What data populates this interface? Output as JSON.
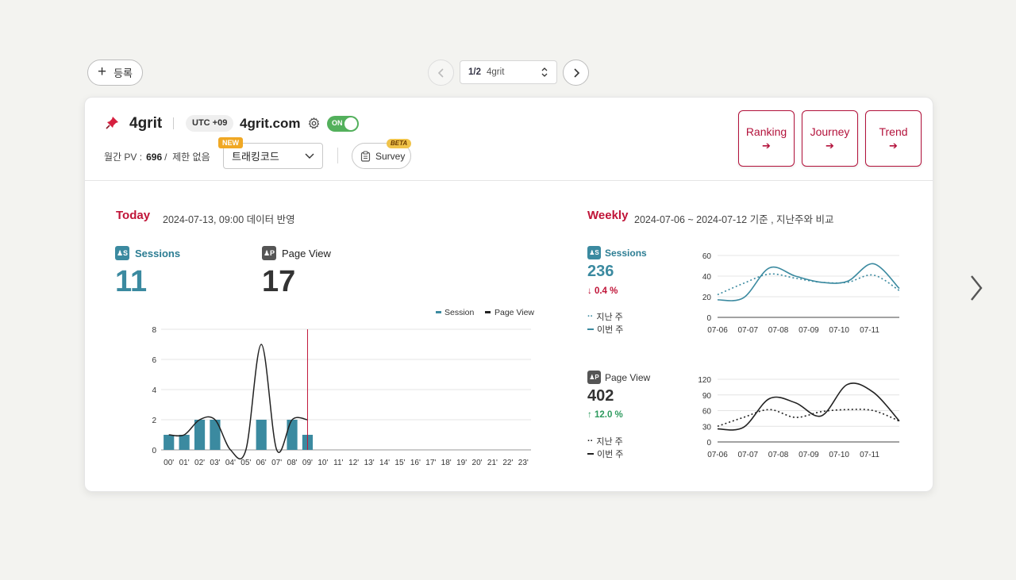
{
  "toolbar": {
    "register_label": "등록",
    "pager_current": "1",
    "pager_total": "2",
    "pager_site": "4grit"
  },
  "site": {
    "name": "4grit",
    "utc": "UTC +09",
    "domain": "4grit.com",
    "toggle_label": "ON",
    "pv_label": "월간 PV :",
    "pv_value": "696",
    "pv_limit": "제한 없음",
    "tracking_code_label": "트래킹코드",
    "new_badge": "NEW",
    "survey_label": "Survey",
    "beta_badge": "BETA"
  },
  "reports": [
    {
      "label": "Ranking"
    },
    {
      "label": "Journey"
    },
    {
      "label": "Trend"
    }
  ],
  "today": {
    "title": "Today",
    "subtitle": "2024-07-13, 09:00 데이터 반영",
    "sessions_label": "Sessions",
    "sessions_value": "11",
    "pageview_label": "Page View",
    "pageview_value": "17"
  },
  "weekly": {
    "title": "Weekly",
    "subtitle": "2024-07-06 ~ 2024-07-12 기준 , 지난주와 비교",
    "sessions_label": "Sessions",
    "sessions_value": "236",
    "sessions_delta": "0.4 %",
    "pageview_label": "Page View",
    "pageview_value": "402",
    "pageview_delta": "12.0 %",
    "legend_last": "지난 주",
    "legend_this": "이번 주"
  },
  "colors": {
    "teal": "#3b8aa0",
    "accent": "#c01438",
    "green": "#2e9a5e",
    "dark": "#222222"
  },
  "icons": [
    "plus-icon",
    "chevron-left-icon",
    "chevron-right-icon",
    "updown-icon",
    "pushpin-icon",
    "gear-icon",
    "chevron-down-icon",
    "clipboard-icon",
    "arrow-right-icon",
    "arrow-down-icon",
    "arrow-up-icon",
    "user-icon"
  ],
  "chart_data": [
    {
      "type": "bar",
      "legend": [
        "Session",
        "Page View"
      ],
      "categories": [
        "00'",
        "01'",
        "02'",
        "03'",
        "04'",
        "05'",
        "06'",
        "07'",
        "08'",
        "09'",
        "10'",
        "11'",
        "12'",
        "13'",
        "14'",
        "15'",
        "16'",
        "17'",
        "18'",
        "19'",
        "20'",
        "21'",
        "22'",
        "23'"
      ],
      "series": [
        {
          "name": "Session",
          "values": [
            1,
            1,
            2,
            2,
            0,
            0,
            2,
            0,
            2,
            1
          ]
        },
        {
          "name": "Page View",
          "values": [
            1,
            1,
            2,
            2,
            0,
            0,
            7,
            0,
            2,
            2
          ]
        }
      ],
      "ylim": [
        0,
        8
      ],
      "yticks": [
        0,
        2,
        4,
        6,
        8
      ],
      "current_hour": "09'"
    },
    {
      "type": "line",
      "x": [
        "07-06",
        "07-07",
        "07-08",
        "07-09",
        "07-10",
        "07-11"
      ],
      "series": [
        {
          "name": "지난 주",
          "values": [
            22,
            33,
            42,
            38,
            34,
            34,
            41,
            26
          ]
        },
        {
          "name": "이번 주",
          "values": [
            17,
            19,
            48,
            40,
            34,
            35,
            52,
            28
          ]
        }
      ],
      "ylim": [
        0,
        60
      ],
      "yticks": [
        0,
        20,
        40,
        60
      ]
    },
    {
      "type": "line",
      "x": [
        "07-06",
        "07-07",
        "07-08",
        "07-09",
        "07-10",
        "07-11"
      ],
      "series": [
        {
          "name": "지난 주",
          "values": [
            30,
            47,
            62,
            47,
            58,
            62,
            60,
            40
          ]
        },
        {
          "name": "이번 주",
          "values": [
            25,
            28,
            83,
            75,
            50,
            110,
            95,
            40
          ]
        }
      ],
      "ylim": [
        0,
        120
      ],
      "yticks": [
        0,
        30,
        60,
        90,
        120
      ]
    }
  ]
}
